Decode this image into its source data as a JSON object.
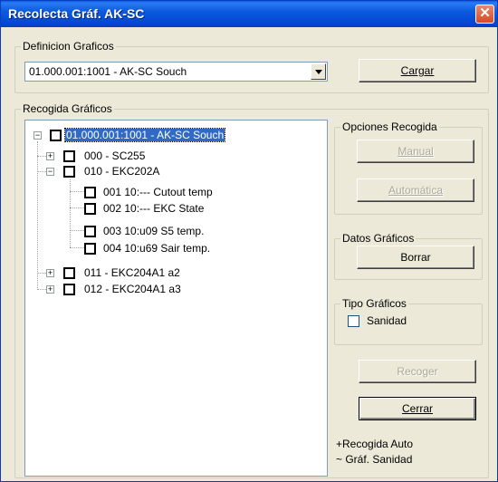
{
  "window": {
    "title": "Recolecta Gráf. AK-SC",
    "close_symbol": "✕"
  },
  "definicion": {
    "legend": "Definicion Graficos",
    "selected": "01.000.001:1001 - AK-SC Souch",
    "cargar_label": "Cargar"
  },
  "recogida": {
    "legend": "Recogida Gráficos",
    "tree": {
      "root": "01.000.001:1001 - AK-SC Souch",
      "n000": "000 - SC255",
      "n010": "010 - EKC202A",
      "c001": "001  10:--- Cutout temp",
      "c002": "002  10:--- EKC State",
      "c003": "003  10:u09 S5 temp.",
      "c004": "004  10:u69 Sair temp.",
      "n011": "011 - EKC204A1 a2",
      "n012": "012 - EKC204A1 a3"
    }
  },
  "opciones": {
    "legend": "Opciones Recogida",
    "manual_label": "Manual",
    "automatica_label": "Automática"
  },
  "datos": {
    "legend": "Datos Gráficos",
    "borrar_label": "Borrar"
  },
  "tipo": {
    "legend": "Tipo Gráficos",
    "sanidad_label": "Sanidad",
    "sanidad_checked": false
  },
  "actions": {
    "recoger_label": "Recoger",
    "cerrar_label": "Cerrar"
  },
  "notes": {
    "auto": "+Recogida Auto",
    "sanidad": "~ Gráf. Sanidad"
  }
}
